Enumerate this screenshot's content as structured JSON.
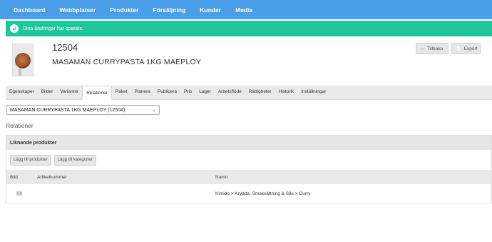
{
  "nav": {
    "items": [
      {
        "label": "Dashboard"
      },
      {
        "label": "Webbplatser"
      },
      {
        "label": "Produkter"
      },
      {
        "label": "Försäljning"
      },
      {
        "label": "Kunder"
      },
      {
        "label": "Media"
      }
    ],
    "active": "Produkter"
  },
  "alert": {
    "message": "Dina ändringar har sparats."
  },
  "product": {
    "id": "12504",
    "name": "MASAMAN CURRYPASTA 1KG MAEPLOY"
  },
  "actions": {
    "back_label": "Tillbaka",
    "export_label": "Export"
  },
  "tabs": [
    {
      "label": "Egenskaper"
    },
    {
      "label": "Bilder"
    },
    {
      "label": "Varianter"
    },
    {
      "label": "Relationer",
      "active": true
    },
    {
      "label": "Paket"
    },
    {
      "label": "Planera"
    },
    {
      "label": "Publicera"
    },
    {
      "label": "Pris"
    },
    {
      "label": "Lager"
    },
    {
      "label": "Arbetsflöde"
    },
    {
      "label": "Rättigheter"
    },
    {
      "label": "Historik"
    },
    {
      "label": "Inställningar"
    }
  ],
  "variant_select": {
    "value": "MASAMAN CURRYPASTA 1KG MAEPLOY (12504)"
  },
  "section": {
    "title": "Relationer"
  },
  "related": {
    "header": "Liknande produkter",
    "add_product_label": "Lägg till produkter",
    "add_category_label": "Lägg till kategorier",
    "columns": {
      "bild": "Bild",
      "artikelnummer": "Artikelnummer",
      "namn": "Namn"
    },
    "rows": [
      {
        "artikelnummer": "",
        "namn": "Kimido > Krydda, Smaksättning & Sås > Curry"
      }
    ]
  },
  "colors": {
    "nav": "#4a9ee8",
    "alert": "#1fc59b"
  }
}
